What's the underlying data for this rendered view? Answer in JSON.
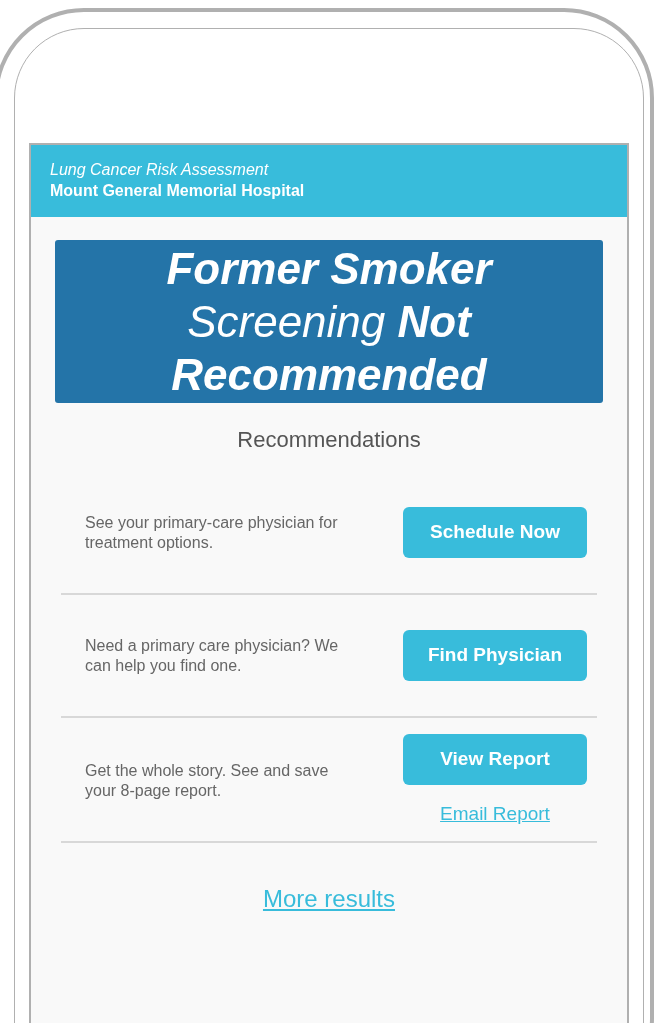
{
  "header": {
    "title": "Lung Cancer Risk Assessment",
    "subtitle": "Mount General Memorial Hospital"
  },
  "banner": "**Former Smoker** Screening **Not Recommended**",
  "section_title": "Recommendations",
  "recommendations": [
    {
      "text": "See your primary-care physician for treatment options.",
      "button": "Schedule Now"
    },
    {
      "text": "Need a primary care physician? We can help you find one.",
      "button": "Find Physician"
    },
    {
      "text": "Get the whole story. See and save your 8-page report.",
      "button": "View Report",
      "link": "Email Report"
    }
  ],
  "more_link": "More results"
}
